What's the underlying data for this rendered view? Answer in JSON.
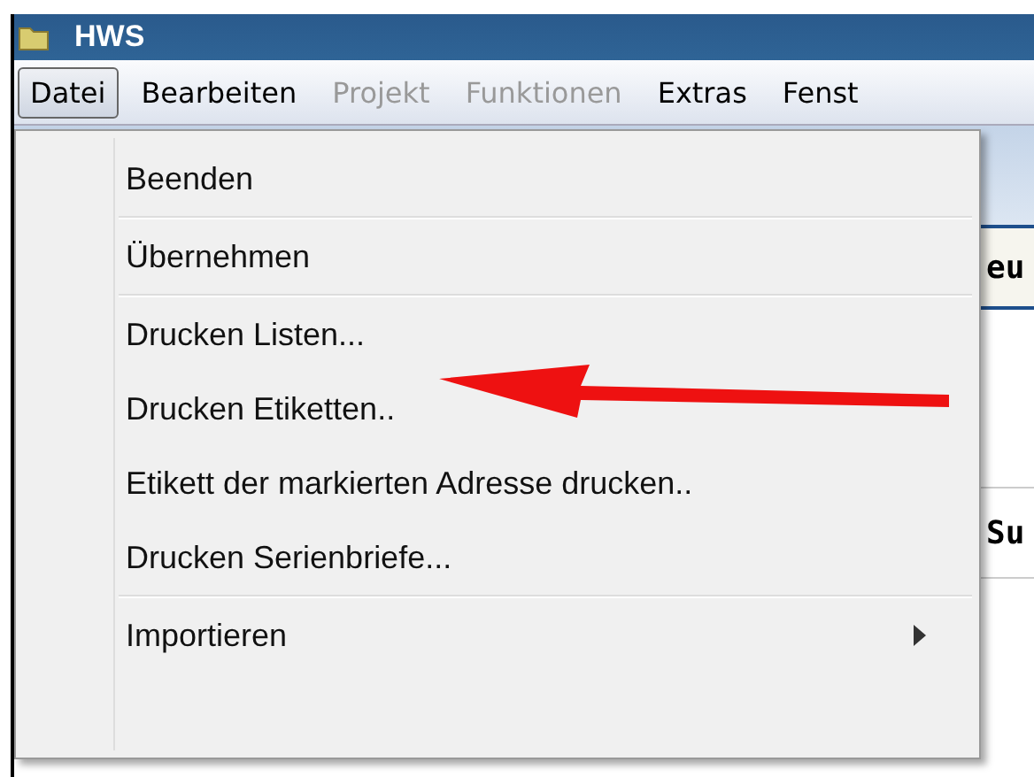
{
  "window": {
    "title": "HWS"
  },
  "menubar": [
    {
      "label": "Datei",
      "selected": true,
      "disabled": false
    },
    {
      "label": "Bearbeiten",
      "selected": false,
      "disabled": false
    },
    {
      "label": "Projekt",
      "selected": false,
      "disabled": true
    },
    {
      "label": "Funktionen",
      "selected": false,
      "disabled": true
    },
    {
      "label": "Extras",
      "selected": false,
      "disabled": false
    },
    {
      "label": "Fenst",
      "selected": false,
      "disabled": false
    }
  ],
  "menu": [
    {
      "kind": "item",
      "label": "Beenden",
      "submenu": false
    },
    {
      "kind": "separator"
    },
    {
      "kind": "item",
      "label": "Übernehmen",
      "submenu": false
    },
    {
      "kind": "separator"
    },
    {
      "kind": "item",
      "label": "Drucken Listen...",
      "submenu": false
    },
    {
      "kind": "item",
      "label": "Drucken Etiketten..",
      "submenu": false
    },
    {
      "kind": "item",
      "label": "Etikett der markierten Adresse drucken..",
      "submenu": false
    },
    {
      "kind": "item",
      "label": "Drucken Serienbriefe...",
      "submenu": false
    },
    {
      "kind": "separator"
    },
    {
      "kind": "item",
      "label": "Importieren",
      "submenu": true
    }
  ],
  "background": {
    "texts": [
      "eu",
      "Su"
    ]
  }
}
